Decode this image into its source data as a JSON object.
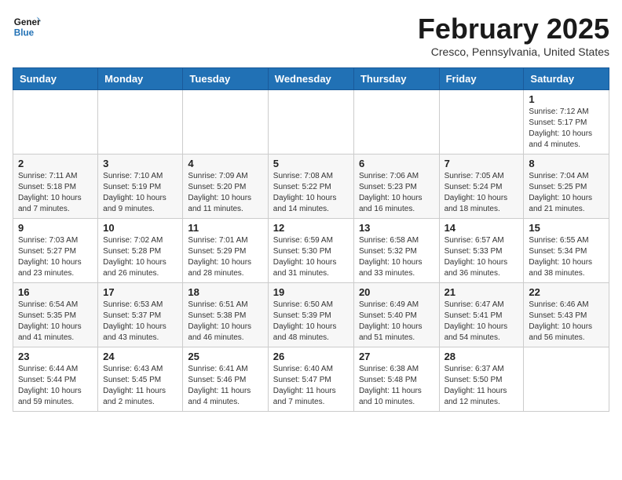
{
  "header": {
    "logo_line1": "General",
    "logo_line2": "Blue",
    "month_title": "February 2025",
    "location": "Cresco, Pennsylvania, United States"
  },
  "days_of_week": [
    "Sunday",
    "Monday",
    "Tuesday",
    "Wednesday",
    "Thursday",
    "Friday",
    "Saturday"
  ],
  "weeks": [
    [
      {
        "day": "",
        "info": ""
      },
      {
        "day": "",
        "info": ""
      },
      {
        "day": "",
        "info": ""
      },
      {
        "day": "",
        "info": ""
      },
      {
        "day": "",
        "info": ""
      },
      {
        "day": "",
        "info": ""
      },
      {
        "day": "1",
        "info": "Sunrise: 7:12 AM\nSunset: 5:17 PM\nDaylight: 10 hours\nand 4 minutes."
      }
    ],
    [
      {
        "day": "2",
        "info": "Sunrise: 7:11 AM\nSunset: 5:18 PM\nDaylight: 10 hours\nand 7 minutes."
      },
      {
        "day": "3",
        "info": "Sunrise: 7:10 AM\nSunset: 5:19 PM\nDaylight: 10 hours\nand 9 minutes."
      },
      {
        "day": "4",
        "info": "Sunrise: 7:09 AM\nSunset: 5:20 PM\nDaylight: 10 hours\nand 11 minutes."
      },
      {
        "day": "5",
        "info": "Sunrise: 7:08 AM\nSunset: 5:22 PM\nDaylight: 10 hours\nand 14 minutes."
      },
      {
        "day": "6",
        "info": "Sunrise: 7:06 AM\nSunset: 5:23 PM\nDaylight: 10 hours\nand 16 minutes."
      },
      {
        "day": "7",
        "info": "Sunrise: 7:05 AM\nSunset: 5:24 PM\nDaylight: 10 hours\nand 18 minutes."
      },
      {
        "day": "8",
        "info": "Sunrise: 7:04 AM\nSunset: 5:25 PM\nDaylight: 10 hours\nand 21 minutes."
      }
    ],
    [
      {
        "day": "9",
        "info": "Sunrise: 7:03 AM\nSunset: 5:27 PM\nDaylight: 10 hours\nand 23 minutes."
      },
      {
        "day": "10",
        "info": "Sunrise: 7:02 AM\nSunset: 5:28 PM\nDaylight: 10 hours\nand 26 minutes."
      },
      {
        "day": "11",
        "info": "Sunrise: 7:01 AM\nSunset: 5:29 PM\nDaylight: 10 hours\nand 28 minutes."
      },
      {
        "day": "12",
        "info": "Sunrise: 6:59 AM\nSunset: 5:30 PM\nDaylight: 10 hours\nand 31 minutes."
      },
      {
        "day": "13",
        "info": "Sunrise: 6:58 AM\nSunset: 5:32 PM\nDaylight: 10 hours\nand 33 minutes."
      },
      {
        "day": "14",
        "info": "Sunrise: 6:57 AM\nSunset: 5:33 PM\nDaylight: 10 hours\nand 36 minutes."
      },
      {
        "day": "15",
        "info": "Sunrise: 6:55 AM\nSunset: 5:34 PM\nDaylight: 10 hours\nand 38 minutes."
      }
    ],
    [
      {
        "day": "16",
        "info": "Sunrise: 6:54 AM\nSunset: 5:35 PM\nDaylight: 10 hours\nand 41 minutes."
      },
      {
        "day": "17",
        "info": "Sunrise: 6:53 AM\nSunset: 5:37 PM\nDaylight: 10 hours\nand 43 minutes."
      },
      {
        "day": "18",
        "info": "Sunrise: 6:51 AM\nSunset: 5:38 PM\nDaylight: 10 hours\nand 46 minutes."
      },
      {
        "day": "19",
        "info": "Sunrise: 6:50 AM\nSunset: 5:39 PM\nDaylight: 10 hours\nand 48 minutes."
      },
      {
        "day": "20",
        "info": "Sunrise: 6:49 AM\nSunset: 5:40 PM\nDaylight: 10 hours\nand 51 minutes."
      },
      {
        "day": "21",
        "info": "Sunrise: 6:47 AM\nSunset: 5:41 PM\nDaylight: 10 hours\nand 54 minutes."
      },
      {
        "day": "22",
        "info": "Sunrise: 6:46 AM\nSunset: 5:43 PM\nDaylight: 10 hours\nand 56 minutes."
      }
    ],
    [
      {
        "day": "23",
        "info": "Sunrise: 6:44 AM\nSunset: 5:44 PM\nDaylight: 10 hours\nand 59 minutes."
      },
      {
        "day": "24",
        "info": "Sunrise: 6:43 AM\nSunset: 5:45 PM\nDaylight: 11 hours\nand 2 minutes."
      },
      {
        "day": "25",
        "info": "Sunrise: 6:41 AM\nSunset: 5:46 PM\nDaylight: 11 hours\nand 4 minutes."
      },
      {
        "day": "26",
        "info": "Sunrise: 6:40 AM\nSunset: 5:47 PM\nDaylight: 11 hours\nand 7 minutes."
      },
      {
        "day": "27",
        "info": "Sunrise: 6:38 AM\nSunset: 5:48 PM\nDaylight: 11 hours\nand 10 minutes."
      },
      {
        "day": "28",
        "info": "Sunrise: 6:37 AM\nSunset: 5:50 PM\nDaylight: 11 hours\nand 12 minutes."
      },
      {
        "day": "",
        "info": ""
      }
    ]
  ]
}
